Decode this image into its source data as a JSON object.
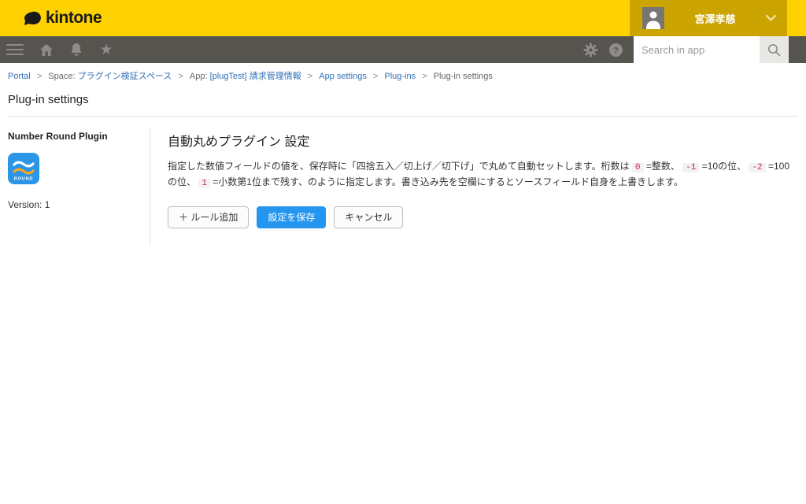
{
  "header": {
    "logo_text": "kintone",
    "user_name": "宮澤孝慈"
  },
  "nav": {
    "search_placeholder": "Search in app"
  },
  "breadcrumb": {
    "separator": ">",
    "portal": "Portal",
    "space_prefix": "Space:",
    "space_link": "プラグイン検証スペース",
    "app_prefix": "App:",
    "app_link": "[plugTest] 請求管理情報",
    "app_settings": "App settings",
    "plugins": "Plug-ins",
    "current": "Plug-in settings"
  },
  "page": {
    "title": "Plug-in settings"
  },
  "sidebar": {
    "plugin_name": "Number Round Plugin",
    "icon_label": "ROUND",
    "version": "Version: 1"
  },
  "main": {
    "heading": "自動丸めプラグイン 設定",
    "description": [
      "指定した数値フィールドの値を、保存時に「四捨五入／切上げ／切下げ」で丸めて自動セットします。桁数は ",
      "0",
      " =整数、 ",
      "-1",
      " =10の位、 ",
      "-2",
      " =100の位、 ",
      "1",
      " =小数第1位まで残す、のように指定します。書き込み先を空欄にするとソースフィールド自身を上書きします。"
    ],
    "buttons": {
      "add_rule": "＋ ルール追加",
      "save": "設定を保存",
      "cancel": "キャンセル"
    }
  },
  "colors": {
    "brand_yellow": "#FED102",
    "user_area_gold": "#CCA400",
    "nav_gray": "#56544E",
    "link_blue": "#3170B9",
    "primary_button_blue": "#2496F0",
    "plugin_icon_blue": "#2B96E8",
    "plugin_icon_orange": "#F5A623"
  }
}
